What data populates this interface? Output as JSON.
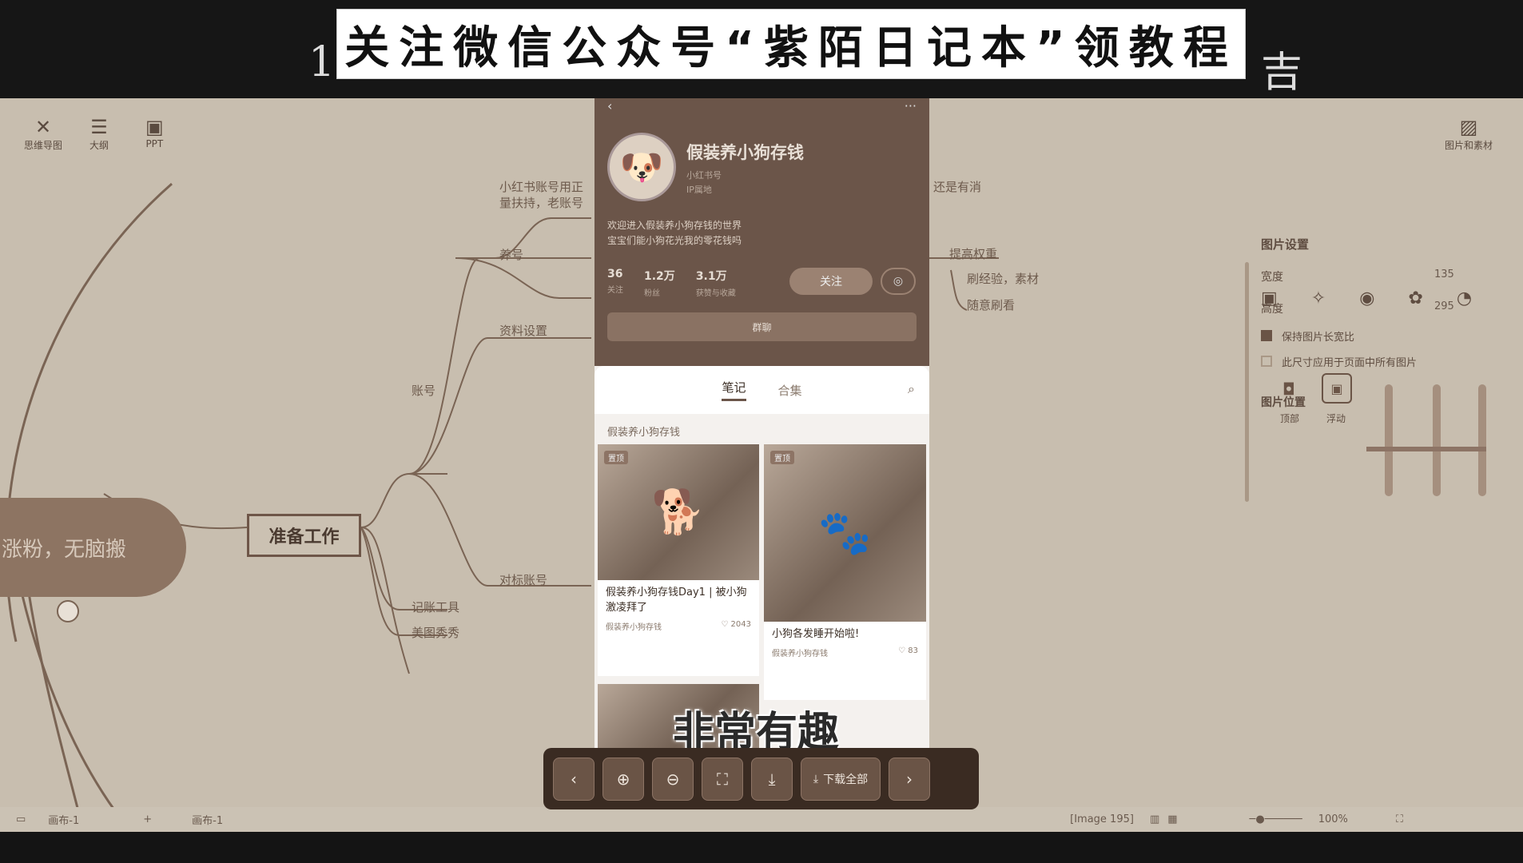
{
  "banner": {
    "text": "关注微信公众号“紫陌日记本”领教程",
    "left_glyph": "1",
    "right_glyph": "吉"
  },
  "toolbar": {
    "items": [
      {
        "label": "思维导图",
        "icon": "cross-icon"
      },
      {
        "label": "大纲",
        "icon": "list-icon"
      },
      {
        "label": "PPT",
        "icon": "ppt-icon"
      }
    ],
    "top_right_label": "图片和素材"
  },
  "mindmap": {
    "center_pill": "涨粉，无脑搬",
    "prep_node": "准备工作",
    "nodes": {
      "account": "账号",
      "raise": "养号",
      "profile": "资料设置",
      "benchmark": "对标账号",
      "tools": "记账工具",
      "meitu": "美图秀秀",
      "desc_1": "小红书账号用正",
      "desc_2": "量扶持，老账号",
      "right_1": "还是有消",
      "weight": "提高权重",
      "experience": "刷经验，素材",
      "random": "随意刷看"
    }
  },
  "phone": {
    "name": "假装养小狗存钱",
    "id_line": "小红书号",
    "ip_line": "IP属地",
    "bio_1": "欢迎进入假装养小狗存钱的世界",
    "bio_2": "宝宝们能小狗花光我的零花钱吗",
    "stats": [
      {
        "value": "36",
        "label": "关注"
      },
      {
        "value": "1.2万",
        "label": "粉丝"
      },
      {
        "value": "3.1万",
        "label": "获赞与收藏"
      }
    ],
    "follow_label": "关注",
    "group_label": "群聊",
    "tabs": [
      "笔记",
      "合集"
    ],
    "album_label": "假装养小狗存钱",
    "cards": [
      {
        "tag": "置顶",
        "title": "假装养小狗存钱Day1 | 被小狗激凌拜了",
        "author": "假装养小狗存钱",
        "likes": "2043"
      },
      {
        "tag": "置顶",
        "title": "小狗各发睡开始啦!",
        "author": "假装养小狗存钱",
        "likes": "83"
      }
    ]
  },
  "subtitle": "非常有趣",
  "viewer": {
    "download_all": "下载全部"
  },
  "right_panel": {
    "section_title": "图片设置",
    "width_label": "宽度",
    "width_value": "135",
    "height_label": "高度",
    "height_value": "295",
    "keep_ratio_label": "保持图片长宽比",
    "apply_all_label": "此尺寸应用于页面中所有图片",
    "position_title": "图片位置",
    "pos_top": "顶部",
    "pos_float": "浮动"
  },
  "status": {
    "page1": "画布-1",
    "page2": "画布-1",
    "image_label": "[Image 195]",
    "zoom": "100%"
  }
}
